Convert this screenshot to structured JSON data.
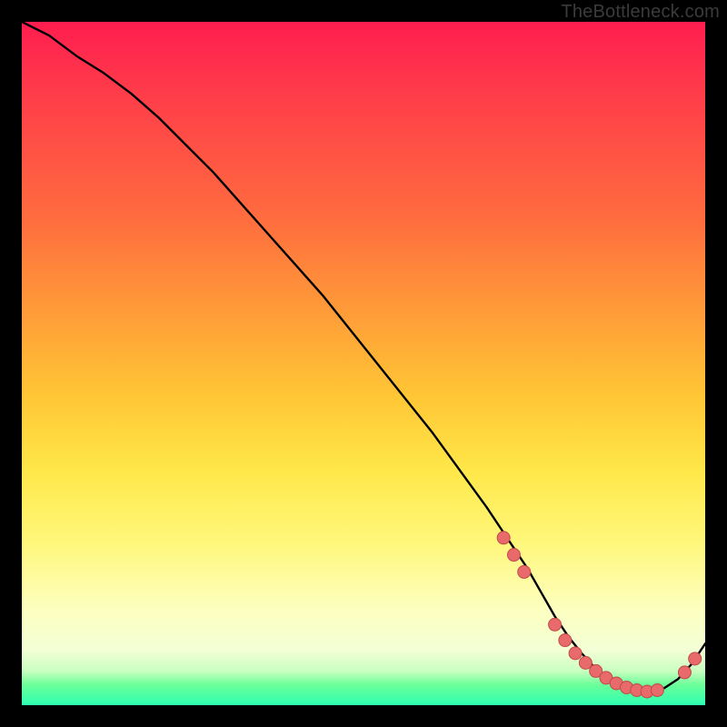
{
  "watermark": "TheBottleneck.com",
  "colors": {
    "frame": "#000000",
    "gradient_top": "#ff1d4f",
    "gradient_mid1": "#ff9a38",
    "gradient_mid2": "#ffe84a",
    "gradient_bottom_band": "#2dffb0",
    "curve_stroke": "#000000",
    "marker_fill": "#e86a6a",
    "marker_stroke": "#c14a4a"
  },
  "chart_data": {
    "type": "line",
    "title": "",
    "xlabel": "",
    "ylabel": "",
    "xlim": [
      0,
      100
    ],
    "ylim": [
      0,
      100
    ],
    "legend": false,
    "grid": false,
    "series": [
      {
        "name": "bottleneck-curve",
        "x": [
          0,
          4,
          8,
          12,
          16,
          20,
          24,
          28,
          32,
          36,
          40,
          44,
          48,
          52,
          56,
          60,
          64,
          68,
          70,
          72,
          74,
          76,
          78,
          80,
          82,
          84,
          86,
          88,
          90,
          92,
          94,
          96,
          98,
          100
        ],
        "y": [
          100,
          98,
          95,
          92.5,
          89.5,
          86,
          82,
          78,
          73.5,
          69,
          64.5,
          60,
          55,
          50,
          45,
          40,
          34.5,
          29,
          26,
          23,
          20,
          16.5,
          13,
          10,
          7.5,
          5.3,
          3.7,
          2.6,
          2.1,
          2.0,
          2.5,
          3.8,
          6.0,
          9.0
        ]
      }
    ],
    "markers": [
      {
        "x": 70.5,
        "y": 24.5
      },
      {
        "x": 72.0,
        "y": 22.0
      },
      {
        "x": 73.5,
        "y": 19.5
      },
      {
        "x": 78.0,
        "y": 11.8
      },
      {
        "x": 79.5,
        "y": 9.5
      },
      {
        "x": 81.0,
        "y": 7.6
      },
      {
        "x": 82.5,
        "y": 6.2
      },
      {
        "x": 84.0,
        "y": 5.0
      },
      {
        "x": 85.5,
        "y": 4.0
      },
      {
        "x": 87.0,
        "y": 3.2
      },
      {
        "x": 88.5,
        "y": 2.6
      },
      {
        "x": 90.0,
        "y": 2.2
      },
      {
        "x": 91.5,
        "y": 2.0
      },
      {
        "x": 93.0,
        "y": 2.2
      },
      {
        "x": 97.0,
        "y": 4.8
      },
      {
        "x": 98.5,
        "y": 6.8
      }
    ]
  }
}
